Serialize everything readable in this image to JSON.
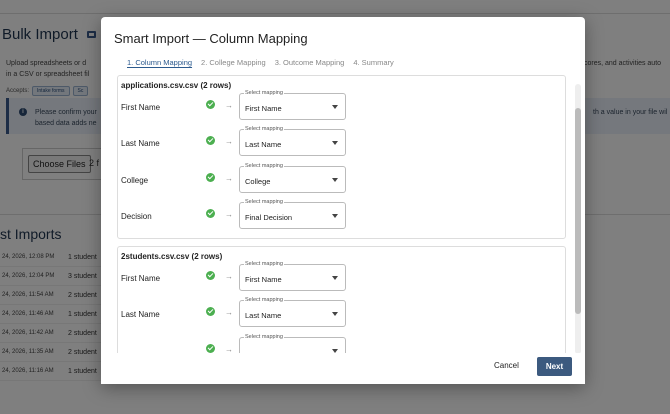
{
  "background": {
    "title": "Bulk Import",
    "description_left": [
      "Upload spreadsheets or d",
      "in a CSV or spreadsheet fil"
    ],
    "description_right": [
      "cores, and activities auto",
      ""
    ],
    "accepts_label": "Accepts:",
    "accepts_chips": [
      "Intake forms",
      "Sc"
    ],
    "alert_text_left": [
      "Please confirm your",
      "based data adds ne"
    ],
    "alert_text_right": [
      "th a value in your file wil",
      ""
    ],
    "choose_files_label": "Choose Files",
    "choose_files_count": "2 f",
    "section_title": "st Imports",
    "imports": [
      {
        "date": "24, 2026, 12:08 PM",
        "count": "1 student"
      },
      {
        "date": "24, 2026, 12:04 PM",
        "count": "3 student"
      },
      {
        "date": "24, 2026, 11:54 AM",
        "count": "2 student"
      },
      {
        "date": "24, 2026, 11:46 AM",
        "count": "1 student"
      },
      {
        "date": "24, 2026, 11:42 AM",
        "count": "2 student"
      },
      {
        "date": "24, 2026, 11:35 AM",
        "count": "2 student"
      },
      {
        "date": "24, 2026, 11:16 AM",
        "count": "1 student"
      }
    ]
  },
  "modal": {
    "title": "Smart Import — Column Mapping",
    "steps": [
      "1. Column Mapping",
      "2. College Mapping",
      "3. Outcome Mapping",
      "4. Summary"
    ],
    "active_step": 0,
    "select_label": "Select mapping",
    "files": [
      {
        "name": "applications.csv.csv (2 rows)",
        "mappings": [
          {
            "column": "First Name",
            "mapping": "First Name"
          },
          {
            "column": "Last Name",
            "mapping": "Last Name"
          },
          {
            "column": "College",
            "mapping": "College"
          },
          {
            "column": "Decision",
            "mapping": "Final Decision"
          }
        ]
      },
      {
        "name": "2students.csv.csv (2 rows)",
        "mappings": [
          {
            "column": "First Name",
            "mapping": "First Name"
          },
          {
            "column": "Last Name",
            "mapping": "Last Name"
          },
          {
            "column": "",
            "mapping": ""
          }
        ]
      }
    ],
    "cancel_label": "Cancel",
    "next_label": "Next"
  },
  "colors": {
    "accent": "#3c5a7f",
    "success": "#4caf50",
    "overlay": "rgba(0,0,0,0.5)"
  }
}
